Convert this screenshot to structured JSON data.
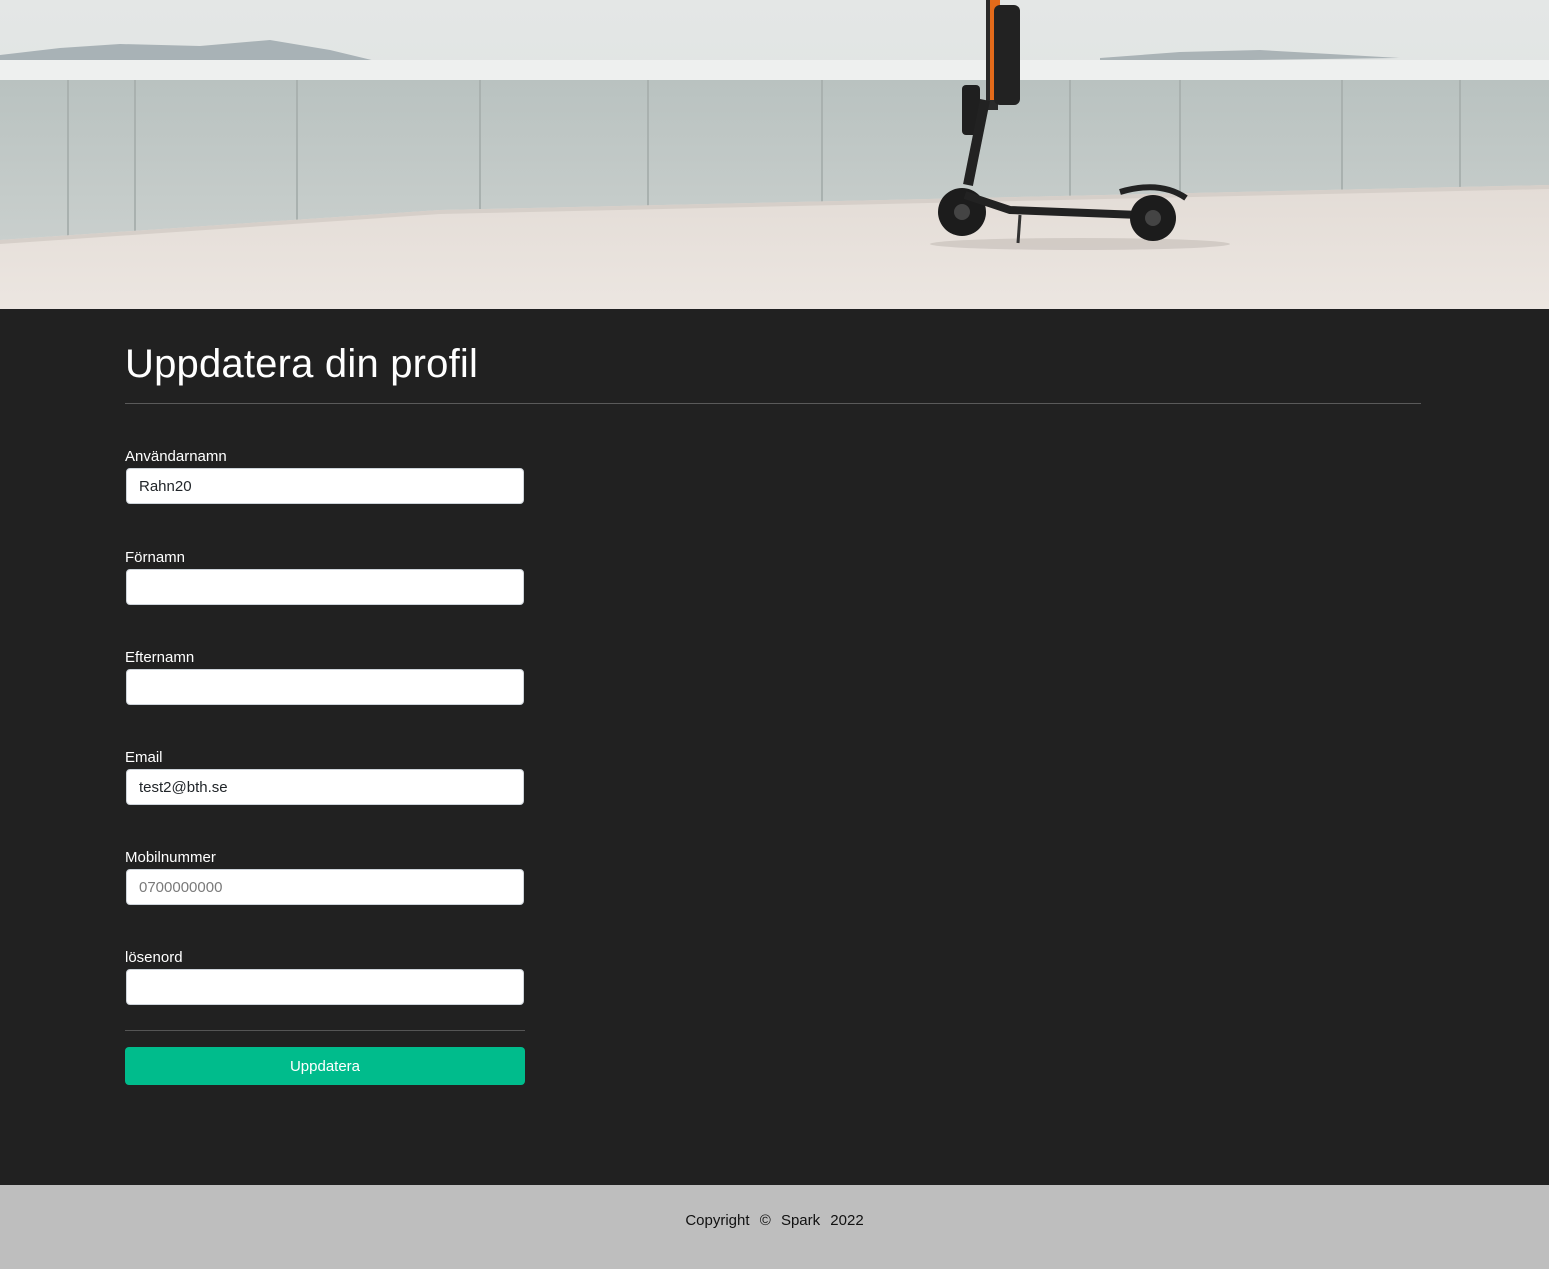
{
  "main": {
    "title": "Uppdatera din profil"
  },
  "form": {
    "fields": [
      {
        "label": "Användarnamn",
        "value": "Rahn20",
        "placeholder": ""
      },
      {
        "label": "Förnamn",
        "value": "",
        "placeholder": ""
      },
      {
        "label": "Efternamn",
        "value": "",
        "placeholder": ""
      },
      {
        "label": "Email",
        "value": "test2@bth.se",
        "placeholder": ""
      },
      {
        "label": "Mobilnummer",
        "value": "",
        "placeholder": "0700000000"
      },
      {
        "label": "lösenord",
        "value": "",
        "placeholder": ""
      }
    ],
    "submit_label": "Uppdatera"
  },
  "footer": {
    "copyright_word": "Copyright",
    "copyright_symbol": "©",
    "brand": "Spark",
    "year": "2022"
  },
  "colors": {
    "background": "#212121",
    "accent": "#00bc8c",
    "footer": "#bebebe"
  }
}
